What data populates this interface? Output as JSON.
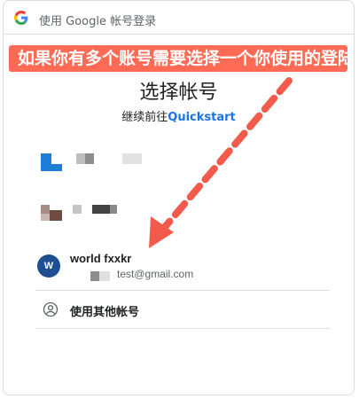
{
  "header": {
    "title": "使用 Google 帐号登录",
    "logo_icon": "google-g-icon"
  },
  "banner": {
    "text": "如果你有多个账号需要选择一个你使用的登陆"
  },
  "main": {
    "title": "选择帐号",
    "subtitle_prefix": "继续前往",
    "app_name": "Quickstart"
  },
  "accounts": [
    {
      "avatar_text": "W",
      "name": "world fxxkr",
      "email": "test@gmail.com"
    }
  ],
  "other_account": {
    "label": "使用其他帐号",
    "icon": "person-circle-icon"
  },
  "colors": {
    "banner_bg": "#ff6a55",
    "link_blue": "#1a73e8",
    "avatar_blue": "#1d4e8f",
    "annotation_arrow": "#f25b4b"
  }
}
